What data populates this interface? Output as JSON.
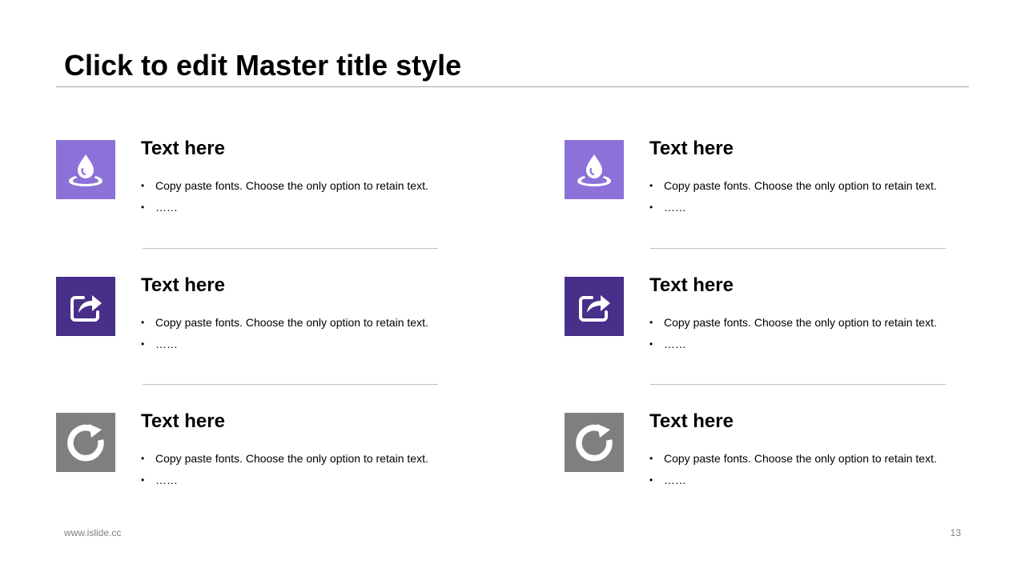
{
  "slide": {
    "title": "Click to edit Master title style"
  },
  "colors": {
    "light_purple": "#8B71D8",
    "dark_purple": "#472F8A",
    "gray": "#7F7F7F"
  },
  "items": [
    {
      "heading": "Text here",
      "bullets": [
        "Copy paste fonts. Choose the only option to retain text.",
        "……"
      ],
      "icon": "water-drop-icon"
    },
    {
      "heading": "Text here",
      "bullets": [
        "Copy paste fonts. Choose the only option to retain text.",
        "……"
      ],
      "icon": "water-drop-icon"
    },
    {
      "heading": "Text here",
      "bullets": [
        "Copy paste fonts. Choose the only option to retain text.",
        "……"
      ],
      "icon": "share-icon"
    },
    {
      "heading": "Text here",
      "bullets": [
        "Copy paste fonts. Choose the only option to retain text.",
        "……"
      ],
      "icon": "share-icon"
    },
    {
      "heading": "Text here",
      "bullets": [
        "Copy paste fonts. Choose the only option to retain text.",
        "……"
      ],
      "icon": "refresh-icon"
    },
    {
      "heading": "Text here",
      "bullets": [
        "Copy paste fonts. Choose the only option to retain text.",
        "……"
      ],
      "icon": "refresh-icon"
    }
  ],
  "footer": {
    "website": "www.islide.cc",
    "page_number": "13"
  }
}
